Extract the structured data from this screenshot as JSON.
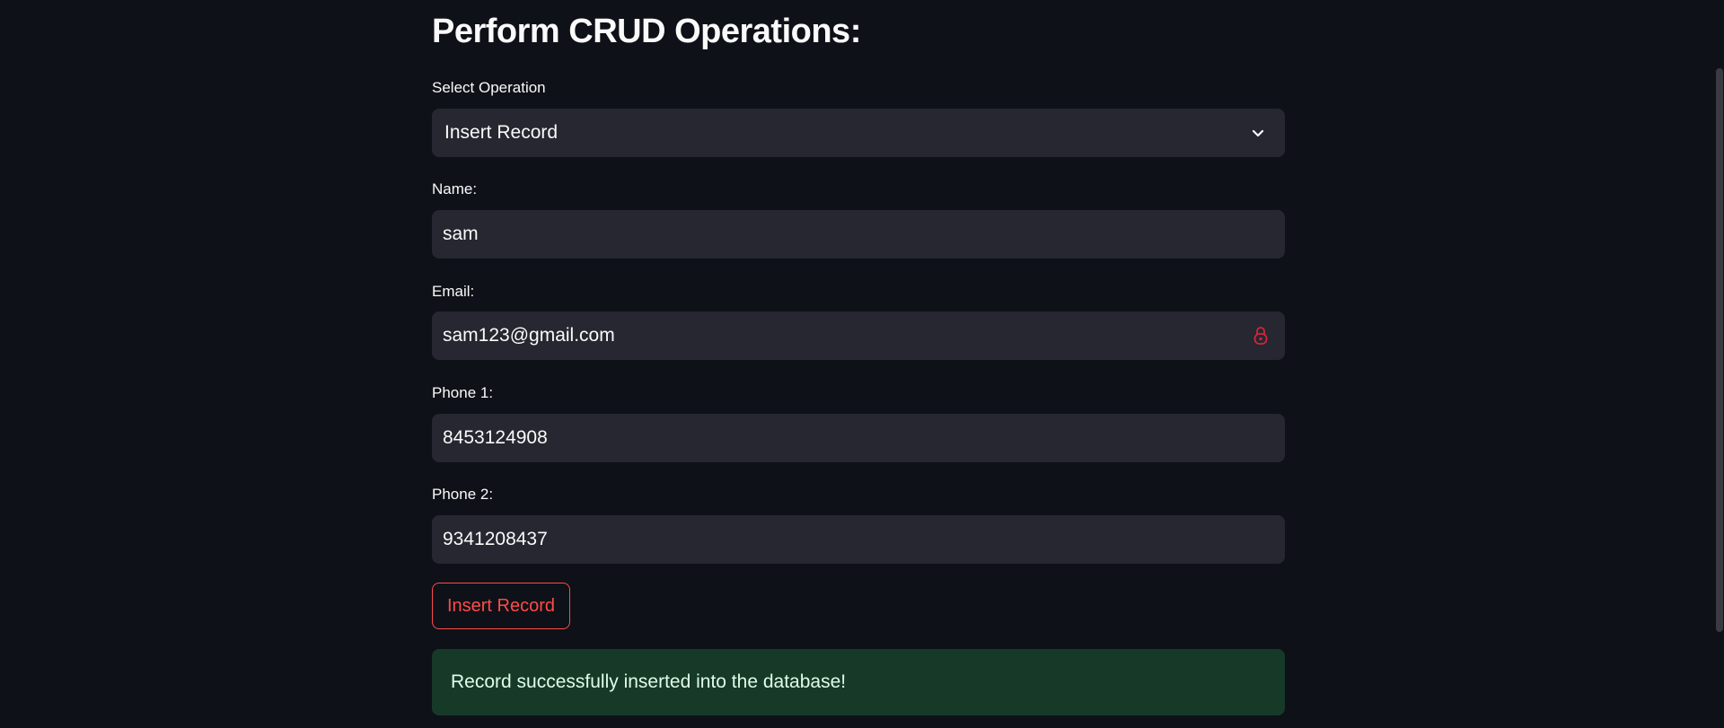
{
  "page": {
    "title": "Perform CRUD Operations:"
  },
  "operation": {
    "label": "Select Operation",
    "selected": "Insert Record"
  },
  "fields": {
    "name": {
      "label": "Name:",
      "value": "sam"
    },
    "email": {
      "label": "Email:",
      "value": "sam123@gmail.com"
    },
    "phone1": {
      "label": "Phone 1:",
      "value": "8453124908"
    },
    "phone2": {
      "label": "Phone 2:",
      "value": "9341208437"
    }
  },
  "actions": {
    "submit_label": "Insert Record"
  },
  "alert": {
    "message": "Record successfully inserted into the database!",
    "status": "success"
  },
  "icons": {
    "select": "chevron-down-icon",
    "email": "lock-icon"
  },
  "colors": {
    "background": "#0e1117",
    "input_bg": "#262730",
    "accent": "#ff4b4b",
    "success_bg": "#173928",
    "success_text": "#dffde9"
  }
}
